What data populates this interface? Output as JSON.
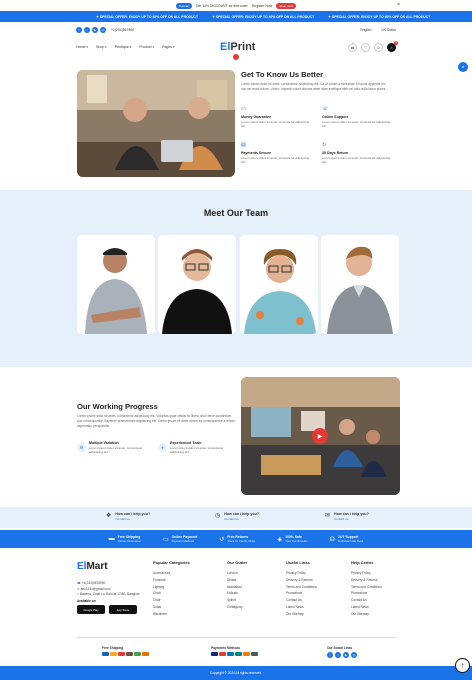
{
  "announce": {
    "badge": "Special",
    "text": "Get 10% DISCOUNT for first order",
    "register": "Register Now",
    "cta": "Shop Now"
  },
  "ticker": [
    "SPECIAL OFFER: ENJOY UP TO 40% OFF ON ALL PRODUCT",
    "SPECIAL OFFER: ENJOY UP TO 40% OFF ON ALL PRODUCT",
    "SPECIAL OFFER: ENJOY UP TO 40% OFF ON ALL PRODUCT"
  ],
  "subheader": {
    "phone": "+1(234)567890",
    "language": "English",
    "currency": "US Dollar"
  },
  "nav": {
    "menu": [
      "Home",
      "Shop",
      "Printique",
      "Product",
      "Pages"
    ],
    "logo_a": "El",
    "logo_b": "Print",
    "cart_count": "0"
  },
  "about": {
    "title": "Get To Know Us Better",
    "desc": "Lorem ipsum dolor sit amet, consectetur adipisicing elit. Ca ut volute a molestiae. Mi quos appiente hic non vel modi dolore. Libero, impenit volunt dolores amet vitae similique nibh vel odio nulla lacus plores.",
    "features": [
      {
        "title": "Money Guarantee",
        "desc": "Lorem ipsum dolor sit amet, consectetur adipisicing elit."
      },
      {
        "title": "Online Support",
        "desc": "Lorem ipsum dolor sit amet, consectetur adipisicing elit."
      },
      {
        "title": "Payments Secure",
        "desc": "Lorem ipsum dolor sit amet, consectetur adipisicing elit."
      },
      {
        "title": "30 Days Return",
        "desc": "Lorem ipsum dolor sit amet, consectetur adipisicing elit."
      }
    ]
  },
  "team": {
    "title": "Meet Our Team"
  },
  "working": {
    "title": "Our Working Progress",
    "desc": "Lorem ipsum dolor sit amet, consectetur adipisicing elit. Voluptas quae officiis fix libero dolor bene laudantium quo consequuntur! Sapiente praesentium adipisicing elit. Lorem ipsum sit amet dolore ea consequuntur a dolore aspernatur perspiciatis.",
    "features": [
      {
        "title": "Multiple Variation",
        "desc": "Lorem ipsum dolor sit amet, consectetur adipisicing elit."
      },
      {
        "title": "Experienced Team",
        "desc": "Lorem ipsum dolor sit amet, consectetur adipisicing elit."
      }
    ]
  },
  "help": [
    {
      "title": "How can i help you?",
      "sub": "Contact us"
    },
    {
      "title": "How can i help you?",
      "sub": "Contact us"
    },
    {
      "title": "How can i help you?",
      "sub": "Contact us"
    }
  ],
  "features": [
    {
      "title": "Free Shipping",
      "sub": "Carrier Information"
    },
    {
      "title": "Online Payment",
      "sub": "Payment Methods"
    },
    {
      "title": "Free Returns",
      "sub": "Track Or Cancle Order"
    },
    {
      "title": "100% Safe",
      "sub": "View Our Benefits"
    },
    {
      "title": "24/7 Support",
      "sub": "Individual Help Desk"
    }
  ],
  "footer": {
    "logo_a": "El",
    "logo_b": "Mart",
    "phone": "+1(234)5678990",
    "email": "abc1234@gmail.com",
    "address": "Mawma, Cupit Lo, Bobota 17/80, Banglore",
    "available": "Available on",
    "stores": [
      "Google Play",
      "App Store"
    ],
    "columns": [
      {
        "title": "Popular Categories",
        "items": [
          "Accessories",
          "Furniture",
          "Lighting",
          "Clock",
          "Chair",
          "Sofas",
          "Wardrobe"
        ]
      },
      {
        "title": "Our Outlet",
        "items": [
          "London",
          "Dhaka",
          "Islamabad",
          "Kolkata",
          "Sylhet",
          "Chittagong"
        ]
      },
      {
        "title": "Useful Links",
        "items": [
          "Privacy Policy",
          "Delivery & Returns",
          "Terms and Conditions",
          "Promotions",
          "Contact Us",
          "Latest News",
          "Our Sitemap"
        ]
      },
      {
        "title": "Help Center",
        "items": [
          "Privacy Policy",
          "Delivery & Returns",
          "Terms and Conditions",
          "Promotions",
          "Contact Us",
          "Latest News",
          "Our Sitemap"
        ]
      }
    ],
    "shipping": "Free Shipping",
    "payments": "Payments Methods",
    "social": "Our Social Links",
    "copyright": "Copyright © 2024 All rights reserved."
  }
}
